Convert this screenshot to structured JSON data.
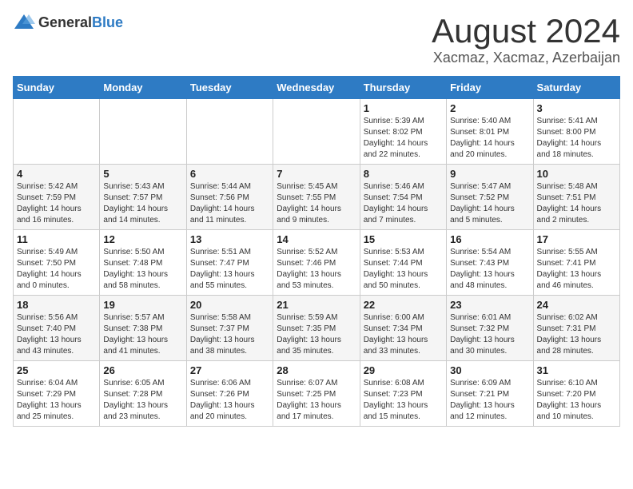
{
  "header": {
    "logo_general": "General",
    "logo_blue": "Blue",
    "month": "August 2024",
    "location": "Xacmaz, Xacmaz, Azerbaijan"
  },
  "days_of_week": [
    "Sunday",
    "Monday",
    "Tuesday",
    "Wednesday",
    "Thursday",
    "Friday",
    "Saturday"
  ],
  "weeks": [
    [
      {
        "day": "",
        "info": ""
      },
      {
        "day": "",
        "info": ""
      },
      {
        "day": "",
        "info": ""
      },
      {
        "day": "",
        "info": ""
      },
      {
        "day": "1",
        "info": "Sunrise: 5:39 AM\nSunset: 8:02 PM\nDaylight: 14 hours\nand 22 minutes."
      },
      {
        "day": "2",
        "info": "Sunrise: 5:40 AM\nSunset: 8:01 PM\nDaylight: 14 hours\nand 20 minutes."
      },
      {
        "day": "3",
        "info": "Sunrise: 5:41 AM\nSunset: 8:00 PM\nDaylight: 14 hours\nand 18 minutes."
      }
    ],
    [
      {
        "day": "4",
        "info": "Sunrise: 5:42 AM\nSunset: 7:59 PM\nDaylight: 14 hours\nand 16 minutes."
      },
      {
        "day": "5",
        "info": "Sunrise: 5:43 AM\nSunset: 7:57 PM\nDaylight: 14 hours\nand 14 minutes."
      },
      {
        "day": "6",
        "info": "Sunrise: 5:44 AM\nSunset: 7:56 PM\nDaylight: 14 hours\nand 11 minutes."
      },
      {
        "day": "7",
        "info": "Sunrise: 5:45 AM\nSunset: 7:55 PM\nDaylight: 14 hours\nand 9 minutes."
      },
      {
        "day": "8",
        "info": "Sunrise: 5:46 AM\nSunset: 7:54 PM\nDaylight: 14 hours\nand 7 minutes."
      },
      {
        "day": "9",
        "info": "Sunrise: 5:47 AM\nSunset: 7:52 PM\nDaylight: 14 hours\nand 5 minutes."
      },
      {
        "day": "10",
        "info": "Sunrise: 5:48 AM\nSunset: 7:51 PM\nDaylight: 14 hours\nand 2 minutes."
      }
    ],
    [
      {
        "day": "11",
        "info": "Sunrise: 5:49 AM\nSunset: 7:50 PM\nDaylight: 14 hours\nand 0 minutes."
      },
      {
        "day": "12",
        "info": "Sunrise: 5:50 AM\nSunset: 7:48 PM\nDaylight: 13 hours\nand 58 minutes."
      },
      {
        "day": "13",
        "info": "Sunrise: 5:51 AM\nSunset: 7:47 PM\nDaylight: 13 hours\nand 55 minutes."
      },
      {
        "day": "14",
        "info": "Sunrise: 5:52 AM\nSunset: 7:46 PM\nDaylight: 13 hours\nand 53 minutes."
      },
      {
        "day": "15",
        "info": "Sunrise: 5:53 AM\nSunset: 7:44 PM\nDaylight: 13 hours\nand 50 minutes."
      },
      {
        "day": "16",
        "info": "Sunrise: 5:54 AM\nSunset: 7:43 PM\nDaylight: 13 hours\nand 48 minutes."
      },
      {
        "day": "17",
        "info": "Sunrise: 5:55 AM\nSunset: 7:41 PM\nDaylight: 13 hours\nand 46 minutes."
      }
    ],
    [
      {
        "day": "18",
        "info": "Sunrise: 5:56 AM\nSunset: 7:40 PM\nDaylight: 13 hours\nand 43 minutes."
      },
      {
        "day": "19",
        "info": "Sunrise: 5:57 AM\nSunset: 7:38 PM\nDaylight: 13 hours\nand 41 minutes."
      },
      {
        "day": "20",
        "info": "Sunrise: 5:58 AM\nSunset: 7:37 PM\nDaylight: 13 hours\nand 38 minutes."
      },
      {
        "day": "21",
        "info": "Sunrise: 5:59 AM\nSunset: 7:35 PM\nDaylight: 13 hours\nand 35 minutes."
      },
      {
        "day": "22",
        "info": "Sunrise: 6:00 AM\nSunset: 7:34 PM\nDaylight: 13 hours\nand 33 minutes."
      },
      {
        "day": "23",
        "info": "Sunrise: 6:01 AM\nSunset: 7:32 PM\nDaylight: 13 hours\nand 30 minutes."
      },
      {
        "day": "24",
        "info": "Sunrise: 6:02 AM\nSunset: 7:31 PM\nDaylight: 13 hours\nand 28 minutes."
      }
    ],
    [
      {
        "day": "25",
        "info": "Sunrise: 6:04 AM\nSunset: 7:29 PM\nDaylight: 13 hours\nand 25 minutes."
      },
      {
        "day": "26",
        "info": "Sunrise: 6:05 AM\nSunset: 7:28 PM\nDaylight: 13 hours\nand 23 minutes."
      },
      {
        "day": "27",
        "info": "Sunrise: 6:06 AM\nSunset: 7:26 PM\nDaylight: 13 hours\nand 20 minutes."
      },
      {
        "day": "28",
        "info": "Sunrise: 6:07 AM\nSunset: 7:25 PM\nDaylight: 13 hours\nand 17 minutes."
      },
      {
        "day": "29",
        "info": "Sunrise: 6:08 AM\nSunset: 7:23 PM\nDaylight: 13 hours\nand 15 minutes."
      },
      {
        "day": "30",
        "info": "Sunrise: 6:09 AM\nSunset: 7:21 PM\nDaylight: 13 hours\nand 12 minutes."
      },
      {
        "day": "31",
        "info": "Sunrise: 6:10 AM\nSunset: 7:20 PM\nDaylight: 13 hours\nand 10 minutes."
      }
    ]
  ]
}
